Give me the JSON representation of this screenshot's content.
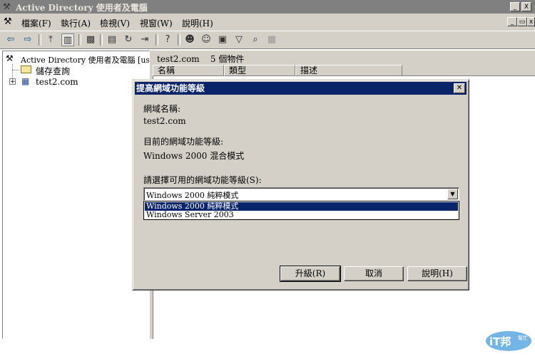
{
  "window": {
    "title": "Active Directory 使用者及電腦"
  },
  "menu": {
    "items": [
      "檔案(F)",
      "執行(A)",
      "檢視(V)",
      "視窗(W)",
      "說明(H)"
    ]
  },
  "tree": {
    "root": "Active Directory 使用者及電腦 [user",
    "saved_queries": "儲存查詢",
    "domain": "test2.com"
  },
  "content": {
    "header": "test2.com    5 個物件",
    "columns": [
      "名稱",
      "類型",
      "描述"
    ]
  },
  "dialog": {
    "title": "提高網域功能等級",
    "domain_name_label": "網域名稱:",
    "domain_name_value": "test2.com",
    "current_level_label": "目前的網域功能等級:",
    "current_level_value": "Windows 2000 混合模式",
    "select_label": "請選擇可用的網域功能等級(S):",
    "combo_value": "Windows 2000 純粹模式",
    "options": [
      "Windows 2000 純粹模式",
      "Windows Server 2003"
    ],
    "buttons": {
      "raise": "升級(R)",
      "cancel": "取消",
      "help": "說明(H)"
    }
  },
  "watermark": {
    "text": "iT邦",
    "sub": "幫忙"
  },
  "colors": {
    "title_active": "#0a246a",
    "title_inactive": "#808080",
    "face": "#d4d0c8"
  }
}
